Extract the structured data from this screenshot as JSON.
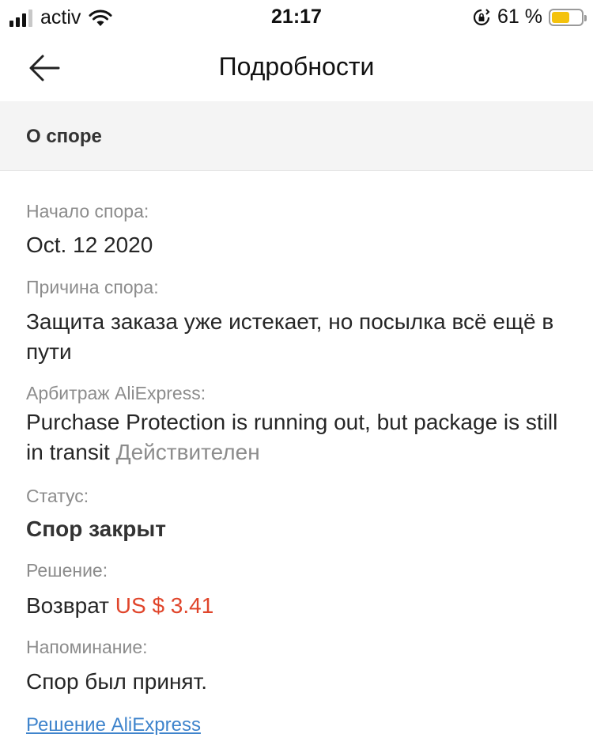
{
  "status_bar": {
    "carrier": "activ",
    "time": "21:17",
    "battery_percent": "61 %",
    "battery_level": 0.61,
    "battery_color": "#f4c20d"
  },
  "nav": {
    "title": "Подробности",
    "back_icon": "arrow-left-icon"
  },
  "section": {
    "title": "О споре"
  },
  "details": {
    "start_label": "Начало спора:",
    "start_value": "Oct. 12 2020",
    "reason_label": "Причина спора:",
    "reason_value": "Защита заказа уже истекает, но посылка всё ещё в пути",
    "arbitration_label": "Арбитраж AliExpress:",
    "arbitration_value": "Purchase Protection is running out, but package is still in transit",
    "arbitration_status": "Действителен",
    "status_label": "Статус:",
    "status_value": "Спор закрыт",
    "decision_label": "Решение:",
    "decision_prefix": "Возврат",
    "decision_amount": "US $ 3.41",
    "reminder_label": "Напоминание:",
    "reminder_value": "Спор был принят.",
    "link_text": "Решение AliExpress"
  },
  "colors": {
    "price": "#e0452b",
    "link": "#3f84cc",
    "section_bg": "#f4f4f4"
  }
}
